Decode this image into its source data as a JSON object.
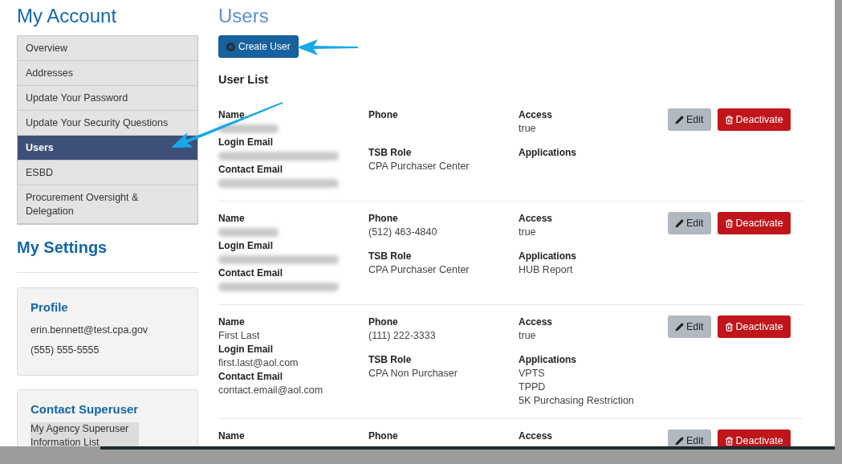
{
  "sidebar": {
    "title": "My Account",
    "items": [
      {
        "label": "Overview",
        "selected": false,
        "arrow": false
      },
      {
        "label": "Addresses",
        "selected": false,
        "arrow": false
      },
      {
        "label": "Update Your Password",
        "selected": false,
        "arrow": false
      },
      {
        "label": "Update Your Security Questions",
        "selected": false,
        "arrow": false
      },
      {
        "label": "Users",
        "selected": true,
        "arrow": true
      },
      {
        "label": "ESBD",
        "selected": false,
        "arrow": false
      },
      {
        "label": "Procurement Oversight & Delegation",
        "selected": false,
        "arrow": false
      }
    ]
  },
  "settings": {
    "title": "My Settings",
    "profile": {
      "title": "Profile",
      "email": "erin.bennett@test.cpa.gov",
      "phone": "(555) 555-5555"
    },
    "contact": {
      "title": "Contact Superuser",
      "link": "My Agency Superuser Information List"
    }
  },
  "main": {
    "title": "Users",
    "create_button": {
      "label": "Create User",
      "arrow": true
    },
    "list_title": "User List",
    "users": [
      {
        "columns": [
          [
            {
              "label": "Name",
              "redacted": true
            },
            {
              "label": "Login Email",
              "redacted": true
            },
            {
              "label": "Contact Email",
              "redacted": true
            }
          ],
          [
            {
              "label": "Phone",
              "redacted": false
            },
            {
              "label": "TSB Role",
              "redacted": false,
              "values": [
                "CPA Purchaser Center"
              ]
            }
          ],
          [
            {
              "label": "Access",
              "redacted": false,
              "values": [
                "true"
              ]
            },
            {
              "label": "Applications",
              "redacted": false
            }
          ]
        ],
        "edit": "Edit",
        "deactivate": "Deactivate"
      },
      {
        "columns": [
          [
            {
              "label": "Name",
              "redacted": true
            },
            {
              "label": "Login Email",
              "redacted": true
            },
            {
              "label": "Contact Email",
              "redacted": true
            }
          ],
          [
            {
              "label": "Phone",
              "redacted": false,
              "values": [
                "(512) 463-4840"
              ]
            },
            {
              "label": "TSB Role",
              "redacted": false,
              "values": [
                "CPA Purchaser Center"
              ]
            }
          ],
          [
            {
              "label": "Access",
              "redacted": false,
              "values": [
                "true"
              ]
            },
            {
              "label": "Applications",
              "redacted": false,
              "values": [
                "HUB Report"
              ]
            }
          ]
        ],
        "edit": "Edit",
        "deactivate": "Deactivate"
      },
      {
        "columns": [
          [
            {
              "label": "Name",
              "redacted": false,
              "values": [
                "First Last"
              ]
            },
            {
              "label": "Login Email",
              "redacted": false,
              "values": [
                "first.last@aol.com"
              ]
            },
            {
              "label": "Contact Email",
              "redacted": false,
              "values": [
                "contact.email@aol.com"
              ]
            }
          ],
          [
            {
              "label": "Phone",
              "redacted": false,
              "values": [
                "(111) 222-3333"
              ]
            },
            {
              "label": "TSB Role",
              "redacted": false,
              "values": [
                "CPA Non Purchaser"
              ]
            }
          ],
          [
            {
              "label": "Access",
              "redacted": false,
              "values": [
                "true"
              ]
            },
            {
              "label": "Applications",
              "redacted": false,
              "values": [
                "VPTS",
                "TPPD",
                "5K Purchasing Restriction"
              ]
            }
          ]
        ],
        "edit": "Edit",
        "deactivate": "Deactivate"
      },
      {
        "columns": [
          [
            {
              "label": "Name",
              "redacted": false
            }
          ],
          [
            {
              "label": "Phone",
              "redacted": false
            }
          ],
          [
            {
              "label": "Access",
              "redacted": false
            }
          ]
        ],
        "edit": "Edit",
        "deactivate": "Deactivate"
      }
    ]
  }
}
